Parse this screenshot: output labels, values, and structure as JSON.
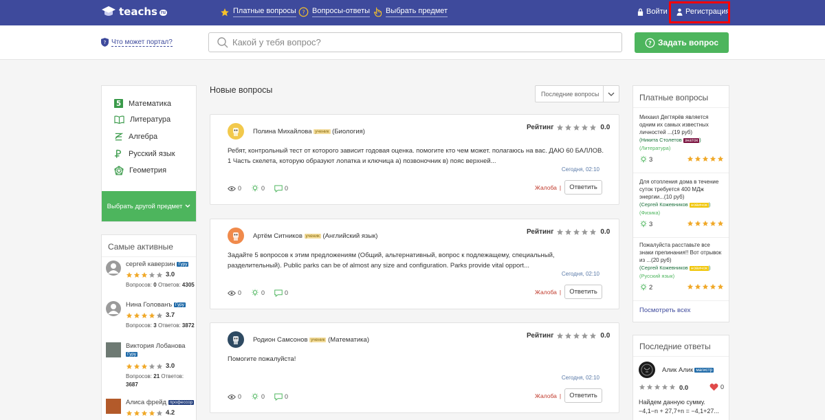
{
  "colors": {
    "brand": "#3e4a9c",
    "accent_green": "#4db55d",
    "star_filled": "#f0a92a",
    "star_empty": "#9a9a9a",
    "highlight_box": "#ff0000"
  },
  "header": {
    "logo_text": "teachs",
    "logo_badge": "ru",
    "nav": [
      {
        "label": "Платные вопросы",
        "icon": "star-icon"
      },
      {
        "label": "Вопросы-ответы",
        "icon": "question-circle-icon"
      },
      {
        "label": "Выбрать предмет",
        "icon": "hand-pointer-icon"
      }
    ],
    "login_label": "Войти",
    "register_label": "Регистрация"
  },
  "subheader": {
    "portal_link": "Что может портал?",
    "search_placeholder": "Какой у тебя вопрос?",
    "ask_button": "Задать вопрос"
  },
  "subjects": {
    "items": [
      {
        "label": "Математика",
        "icon": "math-five-icon"
      },
      {
        "label": "Литература",
        "icon": "book-icon"
      },
      {
        "label": "Алгебра",
        "icon": "algebra-icon"
      },
      {
        "label": "Русский язык",
        "icon": "russian-language-icon"
      },
      {
        "label": "Геометрия",
        "icon": "geometry-icon"
      }
    ],
    "pick_other": "Выбрать другой предмет"
  },
  "most_active": {
    "title": "Самые активные",
    "users": [
      {
        "name": "сергей каверзин",
        "badge": "Гуру",
        "stars": 3,
        "rating": "3.0",
        "questions_label": "Вопросов:",
        "questions": "0",
        "answers_label": "Ответов:",
        "answers": "4305"
      },
      {
        "name": "Нина Голованъ",
        "badge": "Гуру",
        "stars": 4,
        "rating": "3.7",
        "questions_label": "Вопросов:",
        "questions": "3",
        "answers_label": "Ответов:",
        "answers": "3872"
      },
      {
        "name": "Виктория Лобанова",
        "badge": "Гуру",
        "stars": 3,
        "rating": "3.0",
        "questions_label": "Вопросов:",
        "questions": "21",
        "answers_label": "Ответов:",
        "answers": "3687"
      },
      {
        "name": "Алиса фрейд",
        "badge": "профессор",
        "stars": 4,
        "rating": "4.2"
      }
    ]
  },
  "main": {
    "title": "Новые вопросы",
    "sort_label": "Последние вопросы",
    "rating_label": "Рейтинг",
    "complain_label": "Жалоба",
    "answer_label": "Ответить",
    "questions": [
      {
        "author": "Полина Михайлова",
        "badge": "ученик",
        "subject": "(Биология)",
        "rating": "0.0",
        "text": "Ребят, контрольный тест от которого зависит годовая оценка. помогите кто чем может. полагаюсь на вас. ДАЮ 60 БАЛЛОВ. 1 Часть скелета, которую образуют лопатка и ключица а) позвоночник в) пояс верхней...",
        "date": "Сегодня, 02:10",
        "views": "0",
        "likes": "0",
        "comments": "0",
        "avatar_color": "#f2c94c"
      },
      {
        "author": "Артём Ситников",
        "badge": "ученик",
        "subject": "(Английский язык)",
        "rating": "0.0",
        "text": "Задайте 5 вопросов к этим предложениям (Общий, альтернативный, вопрос к подлежащему, специальный, разделительный). Public parks can be of almost any size and configuration. Parks provide vital opport...",
        "date": "Сегодня, 02:10",
        "views": "0",
        "likes": "0",
        "comments": "0",
        "avatar_color": "#f08a4b"
      },
      {
        "author": "Родион Самсонов",
        "badge": "ученик",
        "subject": "(Математика)",
        "rating": "0.0",
        "text": "Помогите пожалуйста!",
        "date": "Сегодня, 02:10",
        "views": "0",
        "likes": "0",
        "comments": "0",
        "avatar_color": "#2e4a62"
      }
    ]
  },
  "paid": {
    "title": "Платные вопросы",
    "see_all": "Посмотреть всех",
    "items": [
      {
        "text": "Михаил Дегтярёв является одним их самых известных личностей ...(19 руб)",
        "author": "(Никита Столетов",
        "badge": "знаток",
        "badge_type": "znatok",
        "close": ")",
        "subject": "(Литература)",
        "count": "3"
      },
      {
        "text": "Для отопления дома в течение суток требуется 400 МДж энергии...(10 руб)",
        "author": "(Сергей Кожевников",
        "badge": "новичок",
        "badge_type": "novice",
        "close": ")",
        "subject": "(Физика)",
        "count": "3"
      },
      {
        "text": "Пожалуйста расставьте все знаки препинания!! Вот отрывок из ...(20 руб)",
        "author": "(Сергей Кожевников",
        "badge": "новичок",
        "badge_type": "novice",
        "close": ")",
        "subject": "(Русский язык)",
        "count": "2"
      }
    ]
  },
  "last_answers": {
    "title": "Последние ответы",
    "user": "Алик Алик",
    "badge": "магистр",
    "rating": "0.0",
    "likes": "0",
    "text": "Найдем данную сумму. −4,1−n + 27,7+n = −4,1+27..."
  }
}
